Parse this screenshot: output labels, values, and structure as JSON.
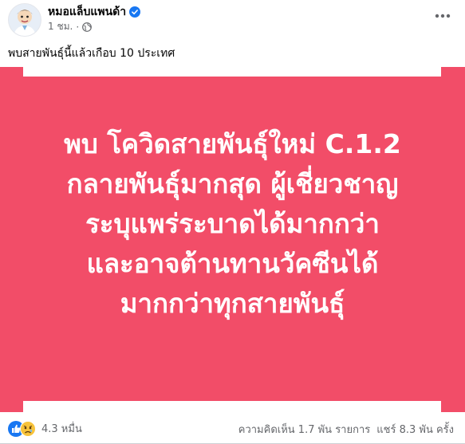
{
  "post": {
    "author_name": "หมอแล็บแพนด้า",
    "time": "1 ชม.",
    "separator": "·",
    "caption": "พบสายพันธุ์นี้แล้วเกือบ 10 ประเทศ"
  },
  "image": {
    "background_color": "#f24d68",
    "headline_lines": [
      "พบ โควิดสายพันธุ์ใหม่ C.1.2",
      "กลายพันธุ์มากสุด ผู้เชี่ยวชาญ",
      "ระบุแพร่ระบาดได้มากกว่า",
      "และอาจต้านทานวัคซีนได้",
      "มากกว่าทุกสายพันธุ์"
    ]
  },
  "stats": {
    "reaction_count": "4.3 หมื่น",
    "comments": "ความคิดเห็น 1.7 พัน รายการ",
    "shares": "แชร์ 8.3 พัน ครั้ง"
  },
  "icons": {
    "verified": "verified-badge-icon",
    "audience": "globe-icon",
    "more": "more-options-icon",
    "reaction_like": "like-reaction-icon",
    "reaction_sad": "sad-reaction-icon"
  },
  "colors": {
    "facebook_blue": "#1877f2",
    "secondary_text": "#65676b",
    "image_red": "#f24d68"
  }
}
